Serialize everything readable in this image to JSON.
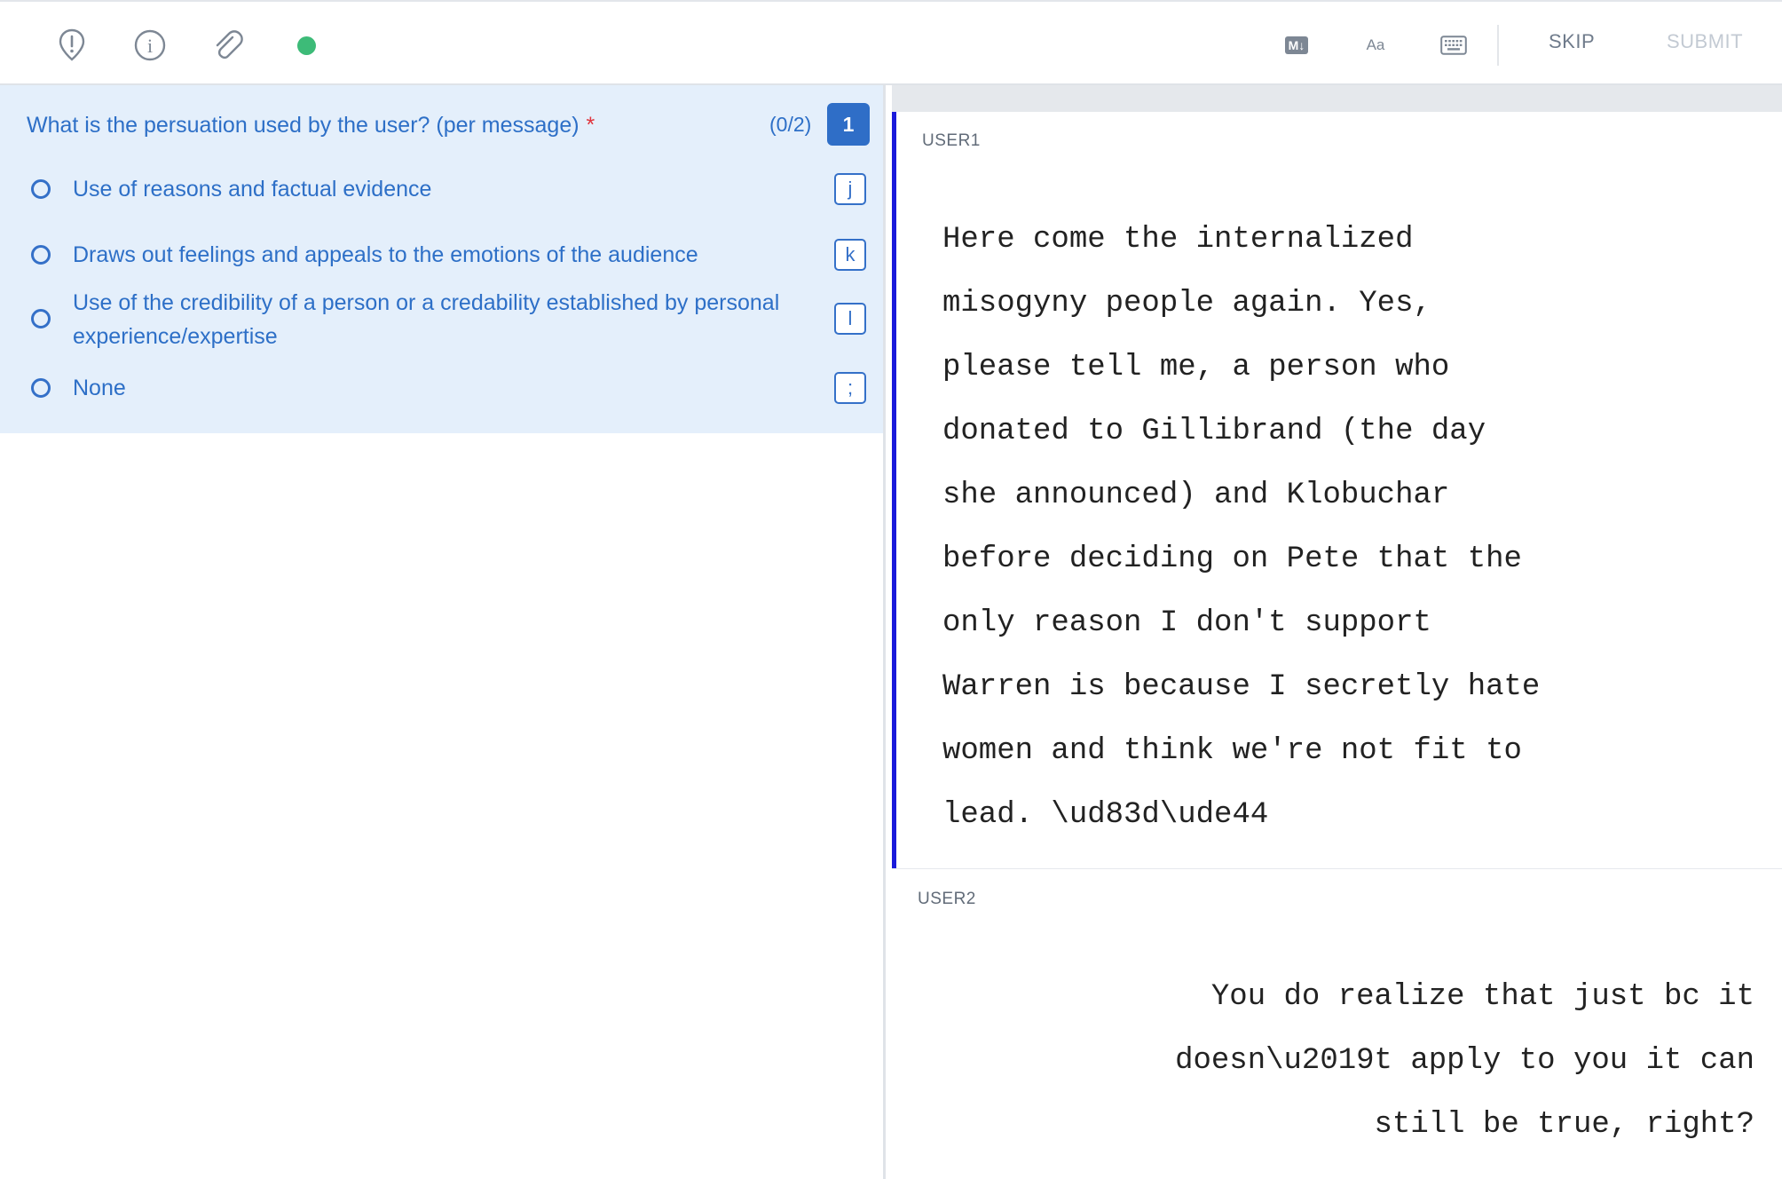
{
  "toolbar": {
    "icons": [
      "alert-icon",
      "info-icon",
      "attachment-icon",
      "status-indicator",
      "markdown-icon",
      "font-size-icon",
      "keyboard-icon"
    ],
    "markdown_label": "M↓",
    "font_label": "Aa",
    "skip_label": "SKIP",
    "submit_label": "SUBMIT",
    "status_color": "#3dbb78"
  },
  "question": {
    "title": "What is the persuation used by the user? (per message)",
    "required_mark": "*",
    "count": "(0/2)",
    "number": "1",
    "options": [
      {
        "label": "Use of reasons and factual evidence",
        "hotkey": "j"
      },
      {
        "label": "Draws out feelings and appeals to the emotions of the audience",
        "hotkey": "k"
      },
      {
        "label": "Use of the credibility of a person or a credability established by personal experience/expertise",
        "hotkey": "l"
      },
      {
        "label": "None",
        "hotkey": ";"
      }
    ]
  },
  "messages": [
    {
      "user": "USER1",
      "text": "Here come the internalized\nmisogyny people again. Yes,\nplease tell me, a person who\ndonated to Gillibrand (the day\nshe announced) and Klobuchar\nbefore deciding on Pete that the\nonly reason I don't support\nWarren is because I secretly hate\nwomen and think we're not fit to\nlead. \\ud83d\\ude44"
    },
    {
      "user": "USER2",
      "text": "You do realize that just bc it\ndoesn\\u2019t apply to you it can\nstill be true, right?"
    }
  ],
  "colors": {
    "accent": "#2f6ec7",
    "panel_bg": "#e4effb",
    "active_border": "#1a1adb",
    "required": "#e0343d"
  }
}
